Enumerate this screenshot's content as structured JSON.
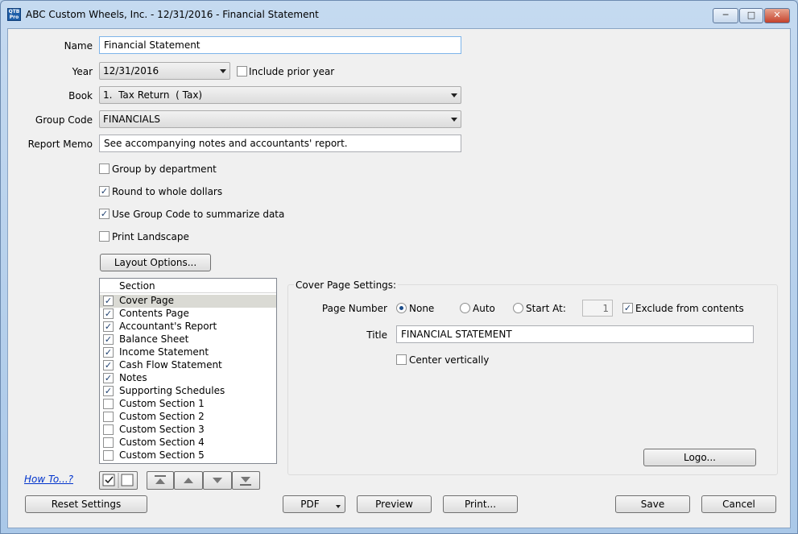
{
  "window": {
    "title": "ABC Custom Wheels, Inc. - 12/31/2016 - Financial Statement",
    "icon_text": "QTB Pro",
    "controls": [
      "minimize-icon",
      "maximize-icon",
      "close-icon"
    ]
  },
  "form": {
    "name_label": "Name",
    "name_value": "Financial Statement",
    "year_label": "Year",
    "year_value": "12/31/2016",
    "include_prior_year_label": "Include prior year",
    "include_prior_year_checked": false,
    "book_label": "Book",
    "book_value": "1.  Tax Return  ( Tax)",
    "group_code_label": "Group Code",
    "group_code_value": "FINANCIALS",
    "report_memo_label": "Report Memo",
    "report_memo_value": "See accompanying notes and accountants' report.",
    "options": [
      {
        "label": "Group by department",
        "checked": false
      },
      {
        "label": "Round to whole dollars",
        "checked": true
      },
      {
        "label": "Use Group Code to summarize data",
        "checked": true
      },
      {
        "label": "Print Landscape",
        "checked": false
      }
    ],
    "layout_options_label": "Layout Options..."
  },
  "sections": {
    "header": "Section",
    "items": [
      {
        "label": "Cover Page",
        "checked": true,
        "selected": true
      },
      {
        "label": "Contents Page",
        "checked": true
      },
      {
        "label": "Accountant's Report",
        "checked": true
      },
      {
        "label": "Balance Sheet",
        "checked": true
      },
      {
        "label": "Income Statement",
        "checked": true
      },
      {
        "label": "Cash Flow Statement",
        "checked": true
      },
      {
        "label": "Notes",
        "checked": true
      },
      {
        "label": "Supporting Schedules",
        "checked": true
      },
      {
        "label": "Custom Section 1",
        "checked": false
      },
      {
        "label": "Custom Section 2",
        "checked": false
      },
      {
        "label": "Custom Section 3",
        "checked": false
      },
      {
        "label": "Custom Section 4",
        "checked": false
      },
      {
        "label": "Custom Section 5",
        "checked": false
      }
    ]
  },
  "cover": {
    "group_title": "Cover Page Settings:",
    "page_number_label": "Page Number",
    "radio_none": "None",
    "radio_auto": "Auto",
    "radio_start_at": "Start At:",
    "page_number_selected": "None",
    "start_at_value": "1",
    "exclude_label": "Exclude from contents",
    "exclude_checked": true,
    "title_label": "Title",
    "title_value": "FINANCIAL STATEMENT",
    "center_label": "Center vertically",
    "center_checked": false,
    "logo_label": "Logo..."
  },
  "footer": {
    "how_to": "How To...?",
    "reset": "Reset Settings",
    "pdf": "PDF",
    "preview": "Preview",
    "print": "Print...",
    "save": "Save",
    "cancel": "Cancel"
  }
}
